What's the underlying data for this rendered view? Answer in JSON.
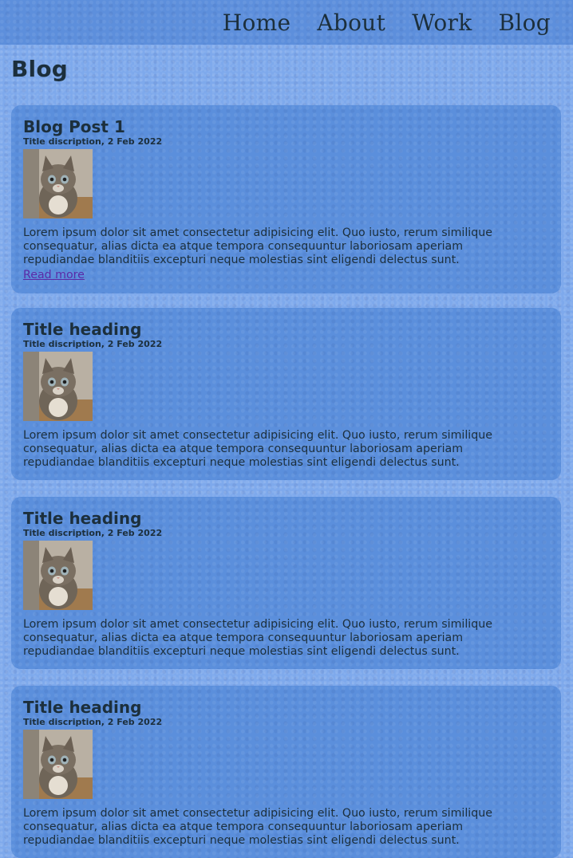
{
  "nav": {
    "items": [
      "Home",
      "About",
      "Work",
      "Blog"
    ]
  },
  "page": {
    "title": "Blog"
  },
  "posts": [
    {
      "title": "Blog Post 1",
      "meta": "Title discription, 2 Feb 2022",
      "image_alt": "kitten photo",
      "body": "Lorem ipsum dolor sit amet consectetur adipisicing elit. Quo iusto, rerum similique consequatur, alias dicta ea atque tempora consequuntur laboriosam aperiam repudiandae blanditiis excepturi neque molestias sint eligendi delectus sunt.",
      "link": "Read more"
    },
    {
      "title": "Title heading",
      "meta": "Title discription, 2 Feb 2022",
      "image_alt": "kitten photo",
      "body": "Lorem ipsum dolor sit amet consectetur adipisicing elit. Quo iusto, rerum similique consequatur, alias dicta ea atque tempora consequuntur laboriosam aperiam repudiandae blanditiis excepturi neque molestias sint eligendi delectus sunt."
    },
    {
      "title": "Title heading",
      "meta": "Title discription, 2 Feb 2022",
      "image_alt": "kitten photo",
      "body": "Lorem ipsum dolor sit amet consectetur adipisicing elit. Quo iusto, rerum similique consequatur, alias dicta ea atque tempora consequuntur laboriosam aperiam repudiandae blanditiis excepturi neque molestias sint eligendi delectus sunt."
    },
    {
      "title": "Title heading",
      "meta": "Title discription, 2 Feb 2022",
      "image_alt": "kitten photo",
      "body": "Lorem ipsum dolor sit amet consectetur adipisicing elit. Quo iusto, rerum similique consequatur, alias dicta ea atque tempora consequuntur laboriosam aperiam repudiandae blanditiis excepturi neque molestias sint eligendi delectus sunt."
    }
  ]
}
